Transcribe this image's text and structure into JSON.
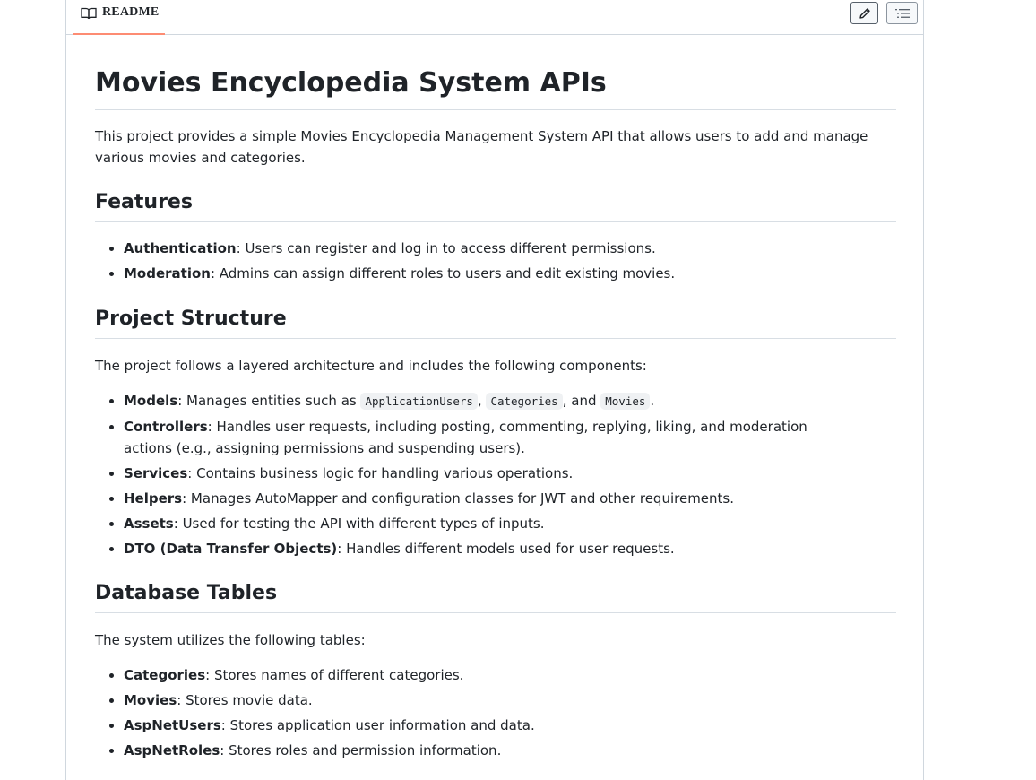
{
  "header": {
    "tab_label": "README",
    "book_icon": "book-icon",
    "edit_icon": "pencil-icon",
    "outline_icon": "list-icon"
  },
  "title": "Movies Encyclopedia System APIs",
  "intro": "This project provides a simple Movies Encyclopedia Management System API that allows users to add and manage various movies and categories.",
  "features": {
    "heading": "Features",
    "items": [
      {
        "term": "Authentication",
        "desc": ": Users can register and log in to access different permissions."
      },
      {
        "term": "Moderation",
        "desc": ": Admins can assign different roles to users and edit existing movies."
      }
    ]
  },
  "structure": {
    "heading": "Project Structure",
    "intro": "The project follows a layered architecture and includes the following components:",
    "models": {
      "term": "Models",
      "desc_before": ": Manages entities such as ",
      "code1": "ApplicationUsers",
      "sep1": ", ",
      "code2": "Categories",
      "sep2": ", and ",
      "code3": "Movies",
      "end": "."
    },
    "items": [
      {
        "term": "Controllers",
        "desc": ": Handles user requests, including posting, commenting, replying, liking, and moderation actions (e.g., assigning permissions and suspending users)."
      },
      {
        "term": "Services",
        "desc": ": Contains business logic for handling various operations."
      },
      {
        "term": "Helpers",
        "desc": ": Manages AutoMapper and configuration classes for JWT and other requirements."
      },
      {
        "term": "Assets",
        "desc": ": Used for testing the API with different types of inputs."
      },
      {
        "term": "DTO (Data Transfer Objects)",
        "desc": ": Handles different models used for user requests."
      }
    ]
  },
  "database": {
    "heading": "Database Tables",
    "intro": "The system utilizes the following tables:",
    "items": [
      {
        "term": "Categories",
        "desc": ": Stores names of different categories."
      },
      {
        "term": "Movies",
        "desc": ": Stores movie data."
      },
      {
        "term": "AspNetUsers",
        "desc": ": Stores application user information and data."
      },
      {
        "term": "AspNetRoles",
        "desc": ": Stores roles and permission information."
      }
    ]
  }
}
